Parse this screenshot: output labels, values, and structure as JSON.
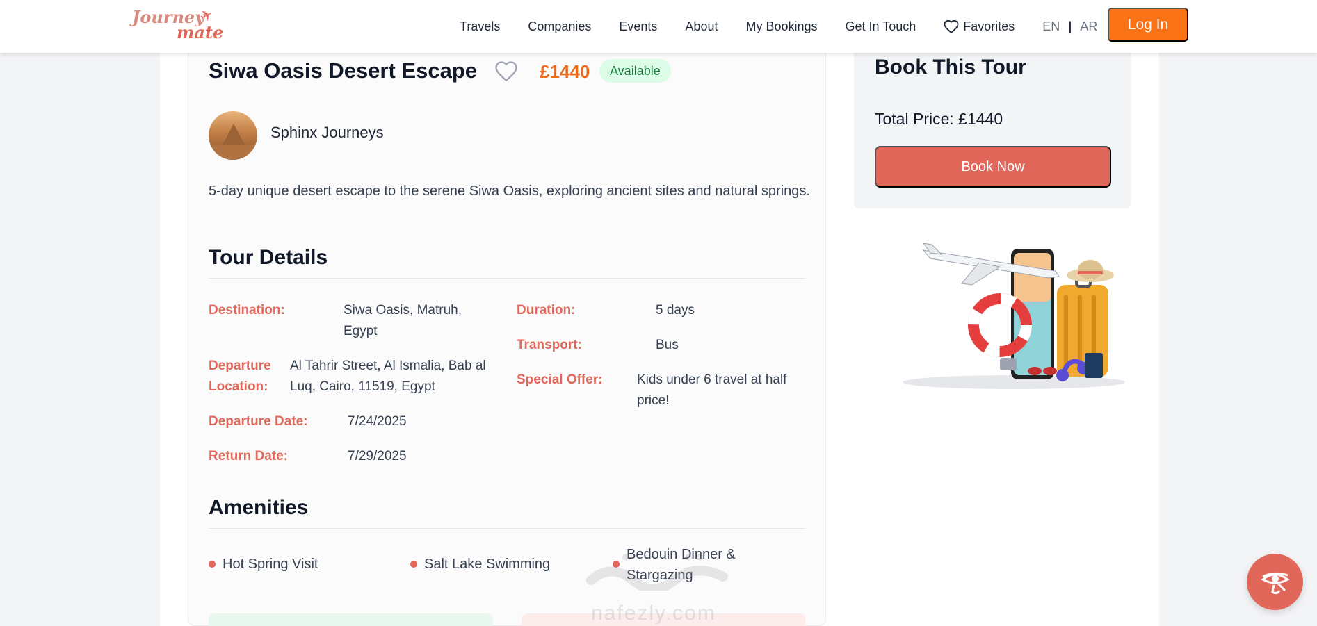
{
  "brand": {
    "logo_line1": "Journey",
    "logo_line2": "mate"
  },
  "nav": {
    "links": [
      "Travels",
      "Companies",
      "Events",
      "About",
      "My Bookings",
      "Get In Touch"
    ],
    "favorites": "Favorites",
    "lang_en": "EN",
    "lang_sep": "|",
    "lang_ar": "AR",
    "login": "Log In"
  },
  "tour": {
    "title": "Siwa Oasis Desert Escape",
    "price": "£1440",
    "status": "Available",
    "company": "Sphinx Journeys",
    "description": "5-day unique desert escape to the serene Siwa Oasis, exploring ancient sites and natural springs."
  },
  "details": {
    "heading": "Tour Details",
    "destination_label": "Destination:",
    "destination_value": "Siwa Oasis, Matruh, Egypt",
    "departure_location_label": "Departure Location:",
    "departure_location_value": "Al Tahrir Street, Al Ismalia, Bab al Luq, Cairo, 11519, Egypt",
    "departure_date_label": "Departure Date:",
    "departure_date_value": "7/24/2025",
    "return_date_label": "Return Date:",
    "return_date_value": "7/29/2025",
    "duration_label": "Duration:",
    "duration_value": "5 days",
    "transport_label": "Transport:",
    "transport_value": "Bus",
    "special_offer_label": "Special Offer:",
    "special_offer_value": "Kids under 6 travel at half price!"
  },
  "amenities": {
    "heading": "Amenities",
    "items": [
      "Hot Spring Visit",
      "Salt Lake Swimming",
      "Bedouin Dinner & Stargazing"
    ]
  },
  "booking": {
    "heading": "Book This Tour",
    "total_price": "Total Price: £1440",
    "book_button": "Book Now"
  },
  "watermark": {
    "latin": "nafezly.com"
  },
  "colors": {
    "accent": "#e0675a",
    "orange": "#f97316",
    "price": "#ea6a1f",
    "success_bg": "#dcfce7",
    "success_text": "#15803d"
  },
  "icons": {
    "favorite": "heart-outline-icon",
    "float": "eye-of-horus-icon"
  }
}
